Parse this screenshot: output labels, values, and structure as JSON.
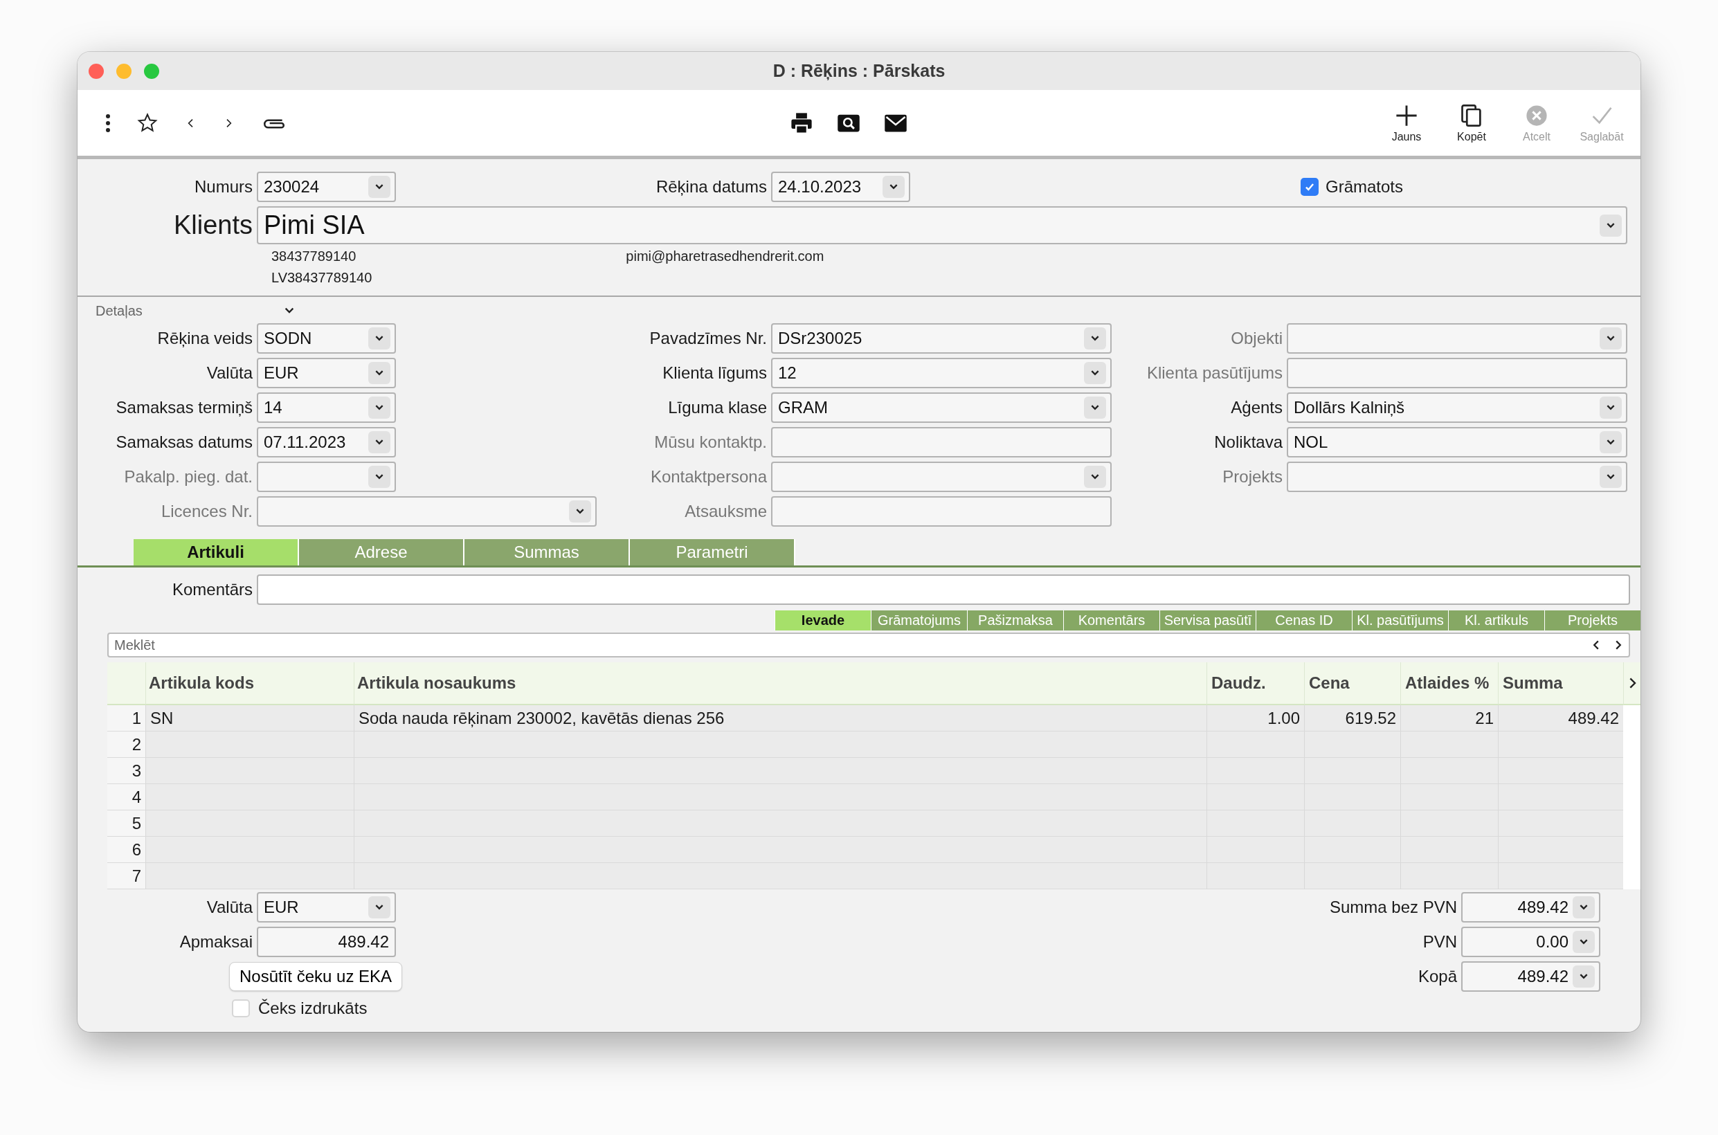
{
  "window": {
    "title": "D : Rēķins : Pārskats"
  },
  "toolbar": {
    "actions": [
      {
        "kind": "new",
        "label": "Jauns",
        "disabled": false
      },
      {
        "kind": "copy",
        "label": "Kopēt",
        "disabled": false
      },
      {
        "kind": "cancel",
        "label": "Atcelt",
        "disabled": true
      },
      {
        "kind": "save",
        "label": "Saglabāt",
        "disabled": true
      }
    ]
  },
  "header": {
    "number": {
      "label": "Numurs",
      "kind": "select",
      "value": "230024"
    },
    "date": {
      "label": "Rēķina datums",
      "kind": "select",
      "value": "24.10.2023"
    },
    "posted": {
      "label": "Grāmatots",
      "checked": true
    },
    "client": {
      "label": "Klients",
      "value": "Pimi SIA",
      "reg_no": "38437789140",
      "email": "pimi@pharetrasedhendrerit.com",
      "vat_no": "LV38437789140"
    }
  },
  "details": {
    "label": "Detaļas",
    "expanded": true,
    "columns": [
      [
        {
          "label": "Rēķina veids",
          "kind": "select",
          "value": "SODN",
          "dimmed": false,
          "wide": false
        },
        {
          "label": "Valūta",
          "kind": "select",
          "value": "EUR",
          "dimmed": false,
          "wide": false
        },
        {
          "label": "Samaksas termiņš",
          "kind": "select",
          "value": "14",
          "dimmed": false,
          "wide": false
        },
        {
          "label": "Samaksas datums",
          "kind": "select",
          "value": "07.11.2023",
          "dimmed": false,
          "wide": false
        },
        {
          "label": "Pakalp. pieg. dat.",
          "kind": "select",
          "dimmed": true,
          "wide": false
        },
        {
          "label": "Licences Nr.",
          "kind": "select",
          "dimmed": true,
          "wide": true
        }
      ],
      [
        {
          "label": "Pavadzīmes Nr.",
          "kind": "select",
          "value": "DSr230025",
          "dimmed": false,
          "wide": false
        },
        {
          "label": "Klienta līgums",
          "kind": "select",
          "value": "12",
          "dimmed": false,
          "wide": false
        },
        {
          "label": "Līguma klase",
          "kind": "select",
          "value": "GRAM",
          "dimmed": false,
          "wide": false
        },
        {
          "label": "Mūsu kontaktp.",
          "kind": "input",
          "dimmed": true,
          "wide": false
        },
        {
          "label": "Kontaktpersona",
          "kind": "select",
          "dimmed": true,
          "wide": false
        },
        {
          "label": "Atsauksme",
          "kind": "input",
          "dimmed": true,
          "wide": false
        }
      ],
      [
        {
          "label": "Objekti",
          "kind": "select",
          "dimmed": true,
          "wide": false
        },
        {
          "label": "Klienta pasūtījums",
          "kind": "input",
          "dimmed": true,
          "wide": false
        },
        {
          "label": "Aģents",
          "kind": "select",
          "value": "Dollārs Kalniņš",
          "dimmed": false,
          "wide": false
        },
        {
          "label": "Noliktava",
          "kind": "select",
          "value": "NOL",
          "dimmed": false,
          "wide": false
        },
        {
          "label": "Projekts",
          "kind": "select",
          "dimmed": true,
          "wide": false
        }
      ]
    ]
  },
  "tabs": [
    {
      "label": "Artikuli",
      "selected": true
    },
    {
      "label": "Adrese",
      "selected": false
    },
    {
      "label": "Summas",
      "selected": false
    },
    {
      "label": "Parametri",
      "selected": false
    }
  ],
  "comment": {
    "label": "Komentārs"
  },
  "subtabs": [
    {
      "label": "Ievade",
      "selected": true
    },
    {
      "label": "Grāmatojums",
      "selected": false
    },
    {
      "label": "Pašizmaksa",
      "selected": false
    },
    {
      "label": "Komentārs",
      "selected": false
    },
    {
      "label": "Servisa pasūtī",
      "selected": false
    },
    {
      "label": "Cenas ID",
      "selected": false
    },
    {
      "label": "Kl. pasūtījums",
      "selected": false
    },
    {
      "label": "Kl. artikuls",
      "selected": false
    },
    {
      "label": "Projekts",
      "selected": false
    }
  ],
  "search": {
    "placeholder": "Meklēt"
  },
  "table": {
    "columns": [
      {
        "label": "Artikula kods",
        "kind": "text"
      },
      {
        "label": "Artikula nosaukums",
        "kind": "text"
      },
      {
        "label": "Daudz.",
        "kind": "number"
      },
      {
        "label": "Cena",
        "kind": "number"
      },
      {
        "label": "Atlaides %",
        "kind": "number"
      },
      {
        "label": "Summa",
        "kind": "number"
      }
    ],
    "rows": [
      {
        "number": "1",
        "cells": [
          "SN",
          "Soda nauda rēķinam 230002, kavētās dienas 256",
          "1.00",
          "619.52",
          "21",
          "489.42"
        ]
      },
      {
        "number": "2"
      },
      {
        "number": "3"
      },
      {
        "number": "4"
      },
      {
        "number": "5"
      },
      {
        "number": "6"
      },
      {
        "number": "7"
      }
    ]
  },
  "totals": {
    "left": [
      {
        "label": "Valūta",
        "kind": "select",
        "value": "EUR"
      },
      {
        "label": "Apmaksai",
        "kind": "number-input",
        "value": "489.42"
      }
    ],
    "send_button": "Nosūtīt čeku uz EKA",
    "receipt": {
      "label": "Čeks izdrukāts",
      "checked": false
    },
    "right": [
      {
        "label": "Summa bez PVN",
        "kind": "number-select",
        "value": "489.42"
      },
      {
        "label": "PVN",
        "kind": "number-select",
        "value": "0.00"
      },
      {
        "label": "Kopā",
        "kind": "number-select",
        "value": "489.42"
      }
    ]
  }
}
